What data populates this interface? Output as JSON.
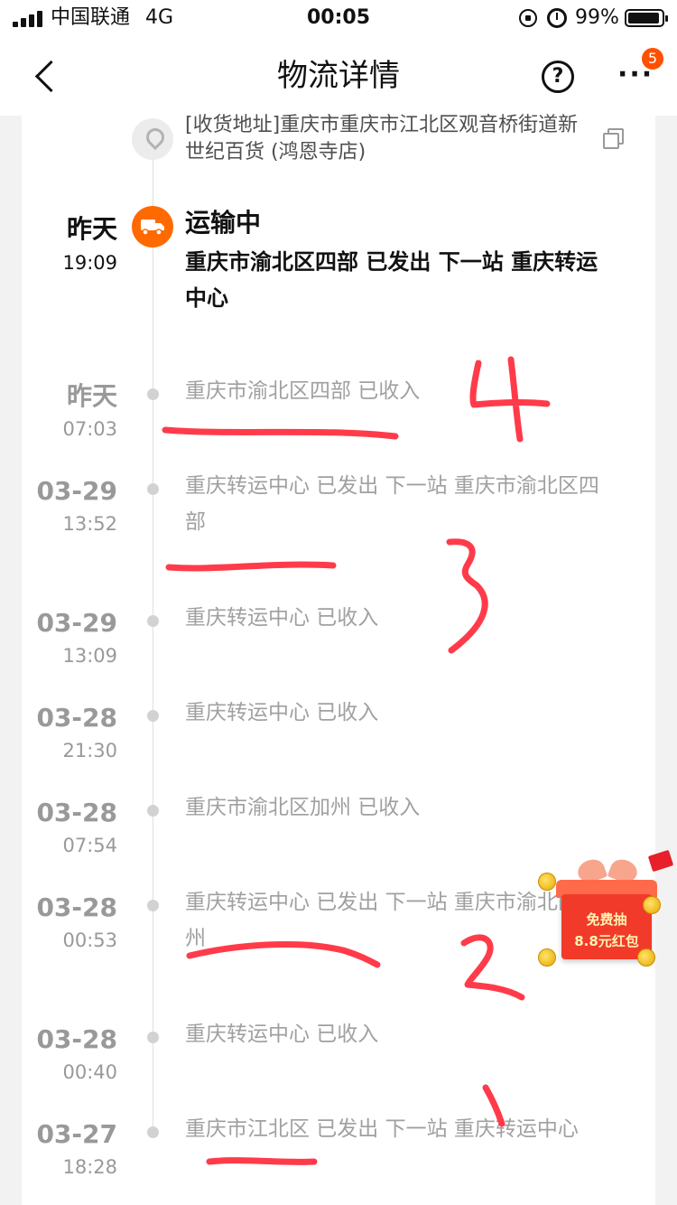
{
  "status_bar": {
    "carrier": "中国联通",
    "network": "4G",
    "time": "00:05",
    "battery": "99%"
  },
  "nav": {
    "title": "物流详情",
    "help_symbol": "?",
    "more_symbol": "···",
    "badge_count": "5"
  },
  "address": {
    "text": "[收货地址]重庆市重庆市江北区观音桥街道新世纪百货 (鸿恩寺店)"
  },
  "current": {
    "date": "昨天",
    "time": "19:09",
    "status": "运输中",
    "detail": "重庆市渝北区四部 已发出 下一站 重庆转运中心"
  },
  "events": [
    {
      "date": "昨天",
      "time": "07:03",
      "text": "重庆市渝北区四部 已收入"
    },
    {
      "date": "03-29",
      "time": "13:52",
      "text": "重庆转运中心 已发出 下一站 重庆市渝北区四部"
    },
    {
      "date": "03-29",
      "time": "13:09",
      "text": "重庆转运中心 已收入"
    },
    {
      "date": "03-28",
      "time": "21:30",
      "text": "重庆转运中心 已收入"
    },
    {
      "date": "03-28",
      "time": "07:54",
      "text": "重庆市渝北区加州 已收入"
    },
    {
      "date": "03-28",
      "time": "00:53",
      "text": "重庆转运中心 已发出 下一站 重庆市渝北区加州"
    },
    {
      "date": "03-28",
      "time": "00:40",
      "text": "重庆转运中心 已收入"
    },
    {
      "date": "03-27",
      "time": "18:28",
      "text": "重庆市江北区 已发出 下一站 重庆转运中心"
    }
  ],
  "promo": {
    "line1": "免费抽",
    "line2": "8.8元红包"
  },
  "colors": {
    "accent": "#ff6a00",
    "badge": "#ff5000",
    "annotation": "#ff3b4a"
  }
}
